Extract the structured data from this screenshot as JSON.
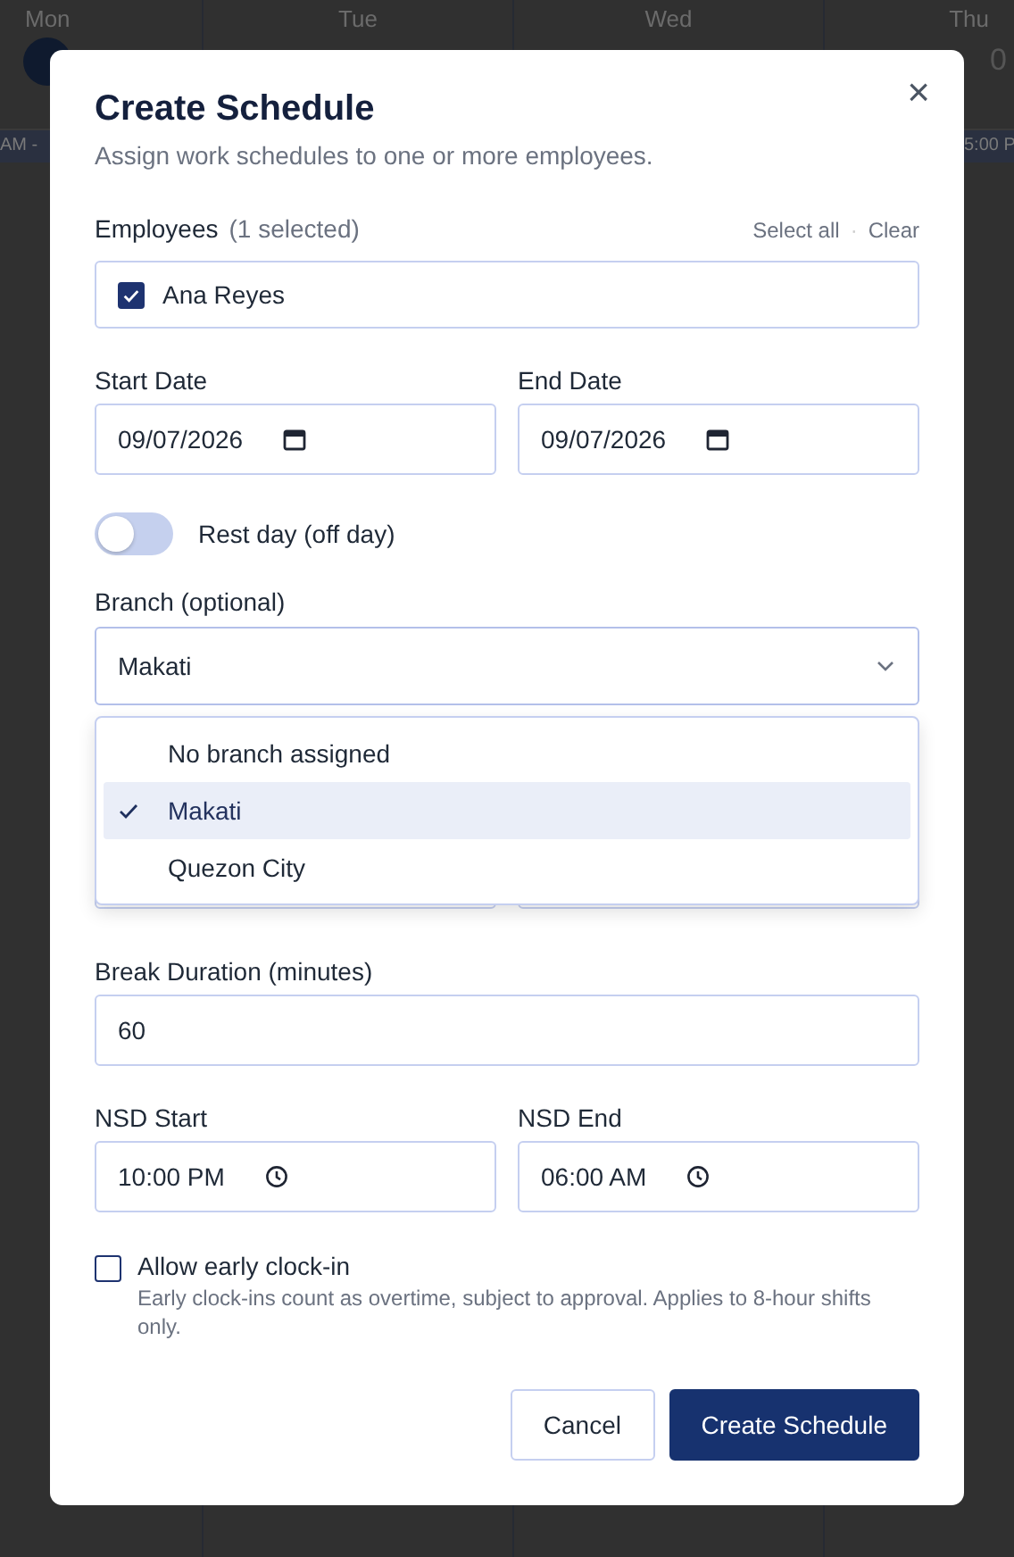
{
  "calendar": {
    "days": [
      {
        "label": "Mon"
      },
      {
        "label": "Tue"
      },
      {
        "label": "Wed"
      },
      {
        "label": "Thu"
      }
    ],
    "thu_date": "0",
    "shift_bars": [
      {
        "text": "AM -"
      },
      {
        "text": "5:00 P"
      }
    ]
  },
  "dialog": {
    "title": "Create Schedule",
    "subtitle": "Assign work schedules to one or more employees.",
    "close": "×",
    "employees": {
      "label": "Employees",
      "count": "(1 selected)",
      "actions": [
        "Select all",
        "Clear"
      ],
      "separator": "·",
      "items": [
        {
          "name": "Ana Reyes",
          "checked": true
        }
      ]
    },
    "start_date": {
      "label": "Start Date",
      "value": "09/07/2026"
    },
    "end_date": {
      "label": "End Date",
      "value": "09/07/2026"
    },
    "rest_day": {
      "label": "Rest day (off day)",
      "on": false
    },
    "branch": {
      "label": "Branch (optional)",
      "value": "Makati",
      "expanded": true,
      "options": [
        {
          "label": "No branch assigned",
          "selected": false
        },
        {
          "label": "Makati",
          "selected": true
        },
        {
          "label": "Quezon City",
          "selected": false
        }
      ]
    },
    "break_duration": {
      "label": "Break Duration (minutes)",
      "value": "60"
    },
    "nsd_start": {
      "label": "NSD Start",
      "value": "10:00 PM"
    },
    "nsd_end": {
      "label": "NSD End",
      "value": "06:00 AM"
    },
    "early_clock_in": {
      "label": "Allow early clock-in",
      "hint": "Early clock-ins count as overtime, subject to approval. Applies to 8-hour shifts only.",
      "checked": false
    },
    "buttons": [
      {
        "label": "Cancel",
        "kind": "secondary"
      },
      {
        "label": "Create Schedule",
        "kind": "primary"
      }
    ]
  }
}
